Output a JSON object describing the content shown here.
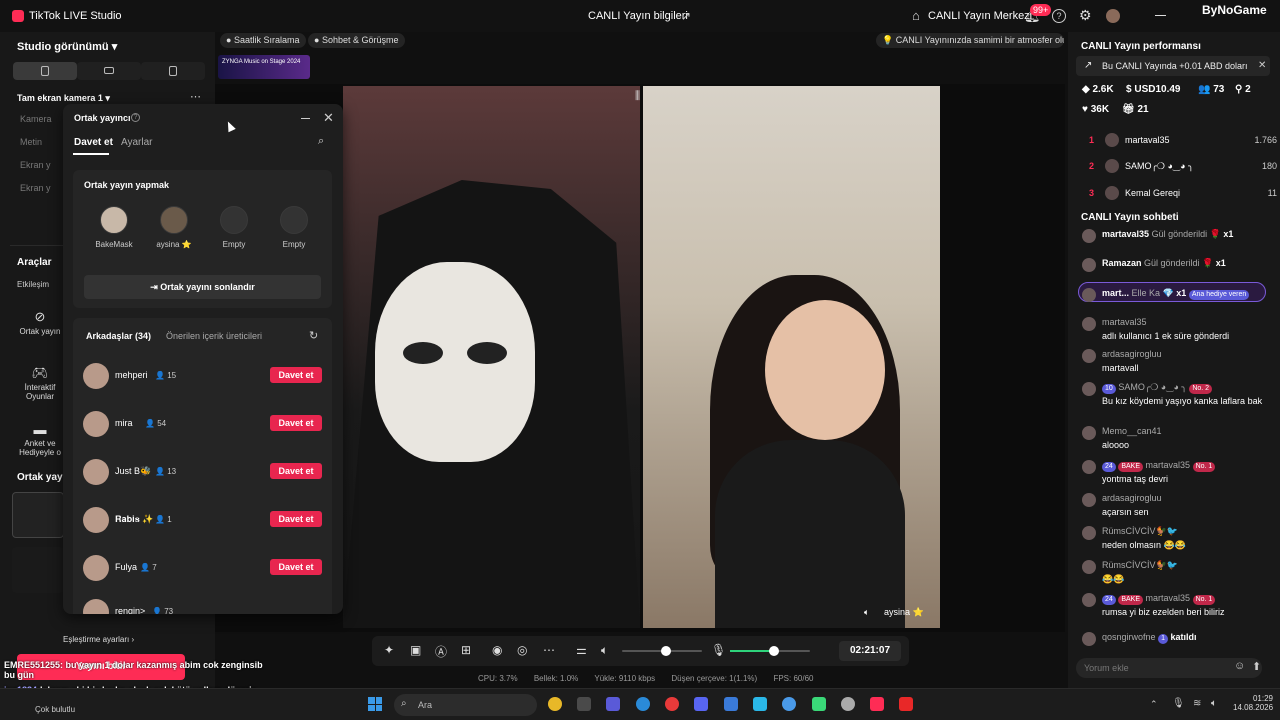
{
  "titlebar": {
    "app_title": "TikTok LIVE Studio",
    "center_title": "CANLI Yayın bilgileri",
    "center2_title": "CANLI Yayın Merkezi",
    "notif_badge": "99+",
    "brand": "ByNoGame"
  },
  "left": {
    "studio_view": "Studio görünümü",
    "camera_title": "Tam ekran kamera 1",
    "sources": [
      "Kamera",
      "Metin",
      "Ekran y",
      "Ekran y"
    ],
    "tools_title": "Araçlar",
    "tools_sub": "Etkileşim",
    "tools": [
      "Ortak yayın",
      "İnteraktif Oyunlar",
      "Anket ve Hediyeyle o"
    ],
    "cohost_section": "Ortak yayı",
    "eslestirme": "Eşleştirme ayarları",
    "end_button": "Yayını bitir"
  },
  "topbar": {
    "chip1": "Saatlik Sıralama",
    "chip2": "Sohbet & Görüşme",
    "banner": "ZYNGA Music on Stage 2024",
    "hint": "CANLI Yayınınızda samimi bir atmosfer olu..."
  },
  "cohost": {
    "title": "Ortak yayıncı",
    "tab_invite": "Davet et",
    "tab_settings": "Ayarlar",
    "card_title": "Ortak yayın yapmak",
    "guests": [
      {
        "name": "BakeMask"
      },
      {
        "name": "aysina ⭐"
      },
      {
        "name": "Empty"
      },
      {
        "name": "Empty"
      }
    ],
    "end_label": "Ortak yayını sonlandır",
    "friends_tab": "Arkadaşlar (34)",
    "suggested_tab": "Önerilen içerik üreticileri",
    "invite_label": "Davet et",
    "friends": [
      {
        "name": "mehperi",
        "count": "15"
      },
      {
        "name": "mira",
        "count": "54"
      },
      {
        "name": "Just B🐝",
        "count": "13"
      },
      {
        "name": "𝐑𝐚𝐛𝐢𝐬 ✨",
        "count": "1"
      },
      {
        "name": "Fulya",
        "count": "7"
      },
      {
        "name": "rengin>",
        "count": "73"
      }
    ]
  },
  "stage": {
    "guest_name": "aysina ⭐"
  },
  "controls": {
    "timer": "02:21:07",
    "volume_level": 0.55,
    "mic_level": 0.55
  },
  "stats": {
    "cpu": "CPU: 3.7%",
    "memory": "Bellek: 1.0%",
    "upload": "Yükle: 9110 kbps",
    "dropped": "Düşen çerçeve: 1(1.1%)",
    "fps": "FPS: 60/60"
  },
  "right": {
    "perf_title": "CANLI Yayın performansı",
    "promo": "Bu CANLI Yayında +0.01 ABD doları",
    "stats": [
      "2.6K",
      "USD10.49",
      "73",
      "2",
      "36K",
      "21"
    ],
    "leaderboard": [
      {
        "rank": "1",
        "name": "martaval35",
        "score": "1.766"
      },
      {
        "rank": "2",
        "name": "SAMO╭❍ ◕‿◕ ╮",
        "score": "180"
      },
      {
        "rank": "3",
        "name": "Kemal Gereqi",
        "score": "11"
      }
    ],
    "chat_title": "CANLI Yayın sohbeti",
    "gifts": [
      {
        "who": "martaval35",
        "txt": "Gül gönderildi",
        "x": "x1"
      },
      {
        "who": "Ramazan",
        "txt": "Gül gönderildi",
        "x": "x1"
      },
      {
        "who": "mart...",
        "txt": "Elle Ka",
        "x": "x1",
        "tag": "Ana hediye veren"
      }
    ],
    "messages": [
      {
        "who": "martaval35",
        "txt": "adlı kullanıcı 1 ek süre gönderdi",
        "badge": ""
      },
      {
        "who": "ardasagirogluu",
        "txt": "martavall",
        "badge": ""
      },
      {
        "who": "SAMO╭❍ ◕‿◕ ╮",
        "txt": "Bu kız köydemi yaşıyo kanka laflara bak",
        "badge": "10",
        "no": "No. 2"
      },
      {
        "who": "Memo__can41",
        "txt": "aloooo",
        "badge": ""
      },
      {
        "who": "martaval35",
        "txt": "yontma taş devri",
        "badge": "24",
        "team": "BAKE",
        "no": "No. 1"
      },
      {
        "who": "ardasagirogluu",
        "txt": "açarsın sen",
        "badge": ""
      },
      {
        "who": "RümsCİVCİV🐓🐦",
        "txt": "neden olmasın 😂😂",
        "badge": ""
      },
      {
        "who": "RümsCİVCİV🐓🐦",
        "txt": "😂😂",
        "badge": ""
      },
      {
        "who": "martaval35",
        "txt": "rumsa yi biz ezelden beri biliriz",
        "badge": "24",
        "team": "BAKE",
        "no": "No. 1"
      },
      {
        "who": "qosngirwofne",
        "txt": "katıldı",
        "badge": "1"
      }
    ],
    "comment_placeholder": "Yorum ekle"
  },
  "overlay_chat": {
    "line1": "EMRE551255: bu yayın 1 dolar kazanmış abim cok zenginsib",
    "line1b": "bu gün",
    "line2": "lekrem abi biz kadın olsak çok kötü yollara düşeriz",
    "line2_user": "iso1834:"
  },
  "taskbar": {
    "search": "Ara",
    "weather": "Çok bulutlu",
    "time": "01:29",
    "date": "14.08.2026"
  }
}
